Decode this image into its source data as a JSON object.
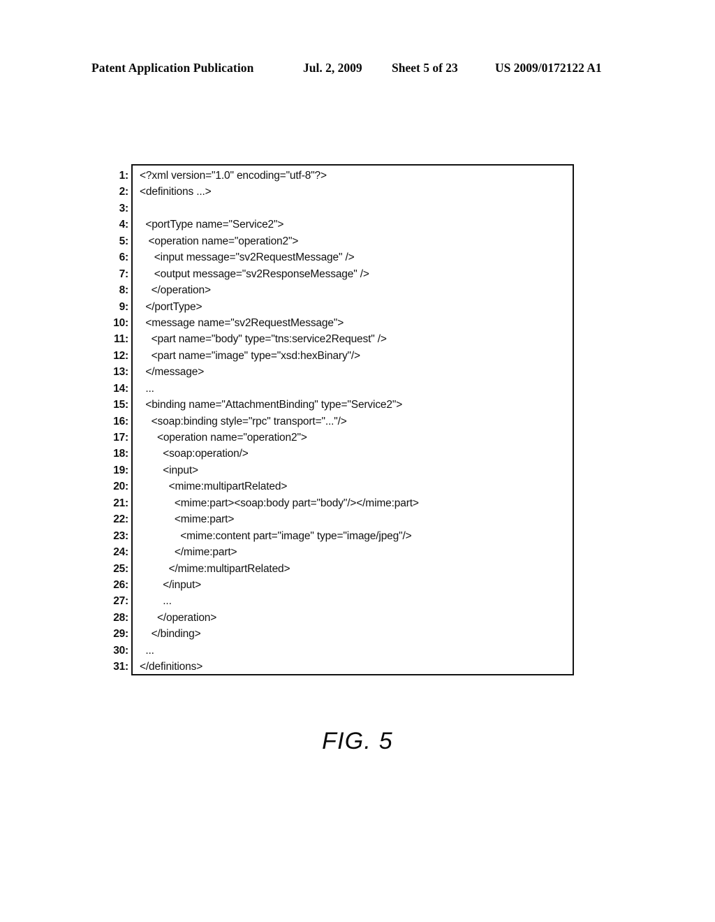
{
  "header": {
    "publication": "Patent Application Publication",
    "date": "Jul. 2, 2009",
    "sheet": "Sheet 5 of 23",
    "doc_id": "US 2009/0172122 A1"
  },
  "figure": {
    "caption": "FIG. 5",
    "listing": {
      "line_numbers": [
        "1:",
        "2:",
        "3:",
        "4:",
        "5:",
        "6:",
        "7:",
        "8:",
        "9:",
        "10:",
        "11:",
        "12:",
        "13:",
        "14:",
        "15:",
        "16:",
        "17:",
        "18:",
        "19:",
        "20:",
        "21:",
        "22:",
        "23:",
        "24:",
        "25:",
        "26:",
        "27:",
        "28:",
        "29:",
        "30:",
        "31:"
      ],
      "lines": [
        "<?xml version=\"1.0\" encoding=\"utf-8\"?>",
        "<definitions ...>",
        "",
        "  <portType name=\"Service2\">",
        "   <operation name=\"operation2\">",
        "     <input message=\"sv2RequestMessage\" />",
        "     <output message=\"sv2ResponseMessage\" />",
        "    </operation>",
        "  </portType>",
        "  <message name=\"sv2RequestMessage\">",
        "    <part name=\"body\" type=\"tns:service2Request\" />",
        "    <part name=\"image\" type=\"xsd:hexBinary\"/>",
        "  </message>",
        "  ...",
        "  <binding name=\"AttachmentBinding\" type=\"Service2\">",
        "    <soap:binding style=\"rpc\" transport=\"...\"/>",
        "      <operation name=\"operation2\">",
        "        <soap:operation/>",
        "        <input>",
        "          <mime:multipartRelated>",
        "            <mime:part><soap:body part=\"body\"/></mime:part>",
        "            <mime:part>",
        "              <mime:content part=\"image\" type=\"image/jpeg\"/>",
        "            </mime:part>",
        "          </mime:multipartRelated>",
        "        </input>",
        "        ...",
        "      </operation>",
        "    </binding>",
        "  ...",
        "</definitions>"
      ]
    }
  }
}
